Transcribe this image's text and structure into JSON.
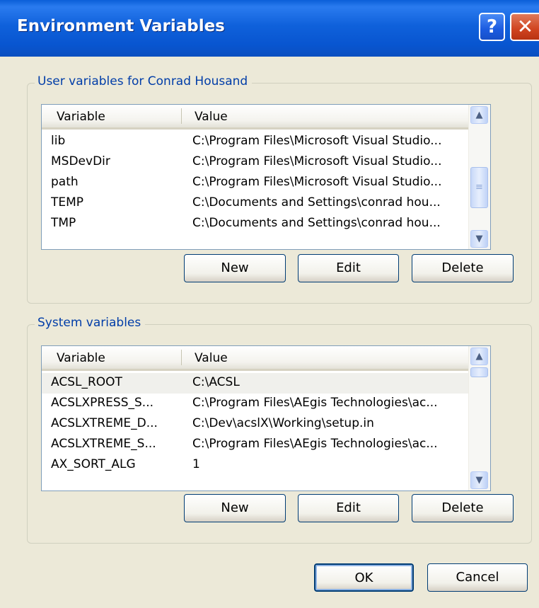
{
  "window": {
    "title": "Environment Variables",
    "help_glyph": "?",
    "close_glyph": "✕"
  },
  "user_vars": {
    "label": "User variables for Conrad Housand",
    "columns": [
      "Variable",
      "Value"
    ],
    "rows": [
      {
        "name": "lib",
        "value": "C:\\Program Files\\Microsoft Visual Studio..."
      },
      {
        "name": "MSDevDir",
        "value": "C:\\Program Files\\Microsoft Visual Studio..."
      },
      {
        "name": "path",
        "value": "C:\\Program Files\\Microsoft Visual Studio..."
      },
      {
        "name": "TEMP",
        "value": "C:\\Documents and Settings\\conrad hou..."
      },
      {
        "name": "TMP",
        "value": "C:\\Documents and Settings\\conrad hou..."
      }
    ],
    "buttons": {
      "new": "New",
      "edit": "Edit",
      "delete": "Delete"
    }
  },
  "system_vars": {
    "label": "System variables",
    "columns": [
      "Variable",
      "Value"
    ],
    "rows": [
      {
        "name": "ACSL_ROOT",
        "value": "C:\\ACSL"
      },
      {
        "name": "ACSLXPRESS_S...",
        "value": "C:\\Program Files\\AEgis Technologies\\ac..."
      },
      {
        "name": "ACSLXTREME_D...",
        "value": "C:\\Dev\\acslX\\Working\\setup.in"
      },
      {
        "name": "ACSLXTREME_S...",
        "value": "C:\\Program Files\\AEgis Technologies\\ac..."
      },
      {
        "name": "AX_SORT_ALG",
        "value": "1"
      }
    ],
    "buttons": {
      "new": "New",
      "edit": "Edit",
      "delete": "Delete"
    }
  },
  "footer": {
    "ok": "OK",
    "cancel": "Cancel"
  },
  "colors": {
    "titlebar": "#0A5FD8",
    "dialog_bg": "#ECE9D8",
    "group_label": "#003DA8",
    "close_button": "#D0441F"
  },
  "icons": {
    "scroll_up": "▲",
    "scroll_down": "▼",
    "thumb_grip": "≡"
  }
}
